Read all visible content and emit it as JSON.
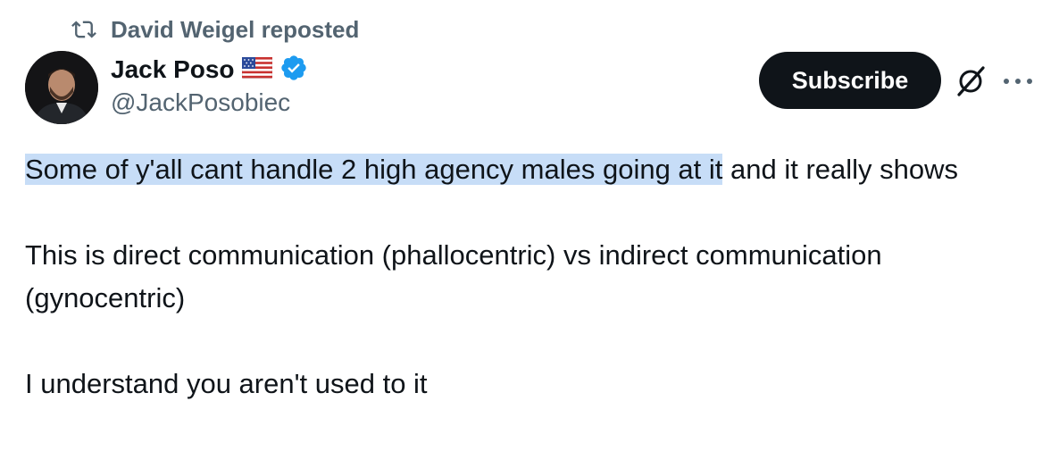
{
  "repost": {
    "text": "David Weigel reposted"
  },
  "author": {
    "display_name": "Jack Poso",
    "flag_emoji": "🇺🇸",
    "handle": "@JackPosobiec",
    "verified": true
  },
  "actions": {
    "subscribe_label": "Subscribe",
    "grok_icon": "grok-icon",
    "more_icon": "more-icon"
  },
  "tweet": {
    "line1_highlighted": "Some of y'all cant handle 2 high agency males going at it",
    "line1_rest": " and it really shows",
    "line2": "This is direct communication (phallocentric) vs indirect communication (gynocentric)",
    "line3": "I understand you aren't used to it"
  },
  "colors": {
    "text": "#0f1419",
    "muted": "#536471",
    "verified_blue": "#1d9bf0",
    "highlight": "#c7ddf7",
    "button_bg": "#0f1419"
  }
}
